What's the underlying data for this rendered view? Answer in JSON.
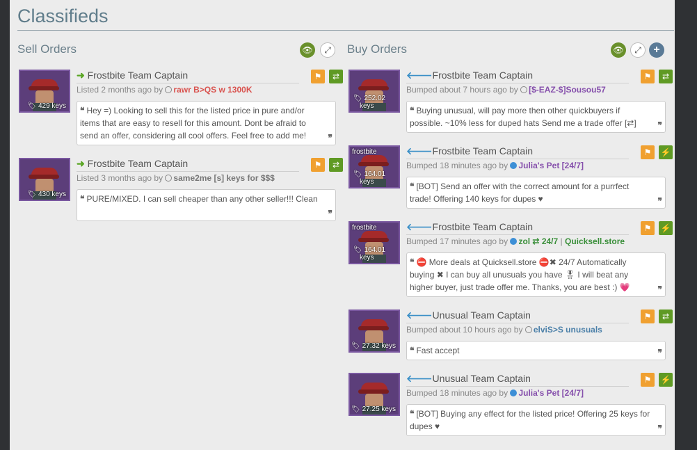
{
  "page_title": "Classifieds",
  "sell": {
    "title": "Sell Orders",
    "items": [
      {
        "name": "Frostbite Team Captain",
        "price": "429 keys",
        "meta_prefix": "Listed 2 months ago by",
        "user": "rawr B>QS w 1300K",
        "comment": "Hey =) Looking to sell this for the listed price in pure and/or items that are easy to resell for this amount. Dont be afraid to send an offer, considering all cool offers. Feel free to add me!"
      },
      {
        "name": "Frostbite Team Captain",
        "price": "430 keys",
        "meta_prefix": "Listed 3 months ago by",
        "user": "same2me [s] keys for $$$",
        "comment": "PURE/MIXED. I can sell cheaper than any other seller!!! Clean"
      }
    ]
  },
  "buy": {
    "title": "Buy Orders",
    "items": [
      {
        "name": "Frostbite Team Captain",
        "price_value": "252.02",
        "price_unit": "keys",
        "meta_prefix": "Bumped about 7 hours ago by",
        "user": "[$-EAZ-$]Sousou57",
        "comment": "Buying unusual, will pay more then other quickbuyers if possible. ~10% less for duped hats Send me a trade offer [⇄]"
      },
      {
        "name": "Frostbite Team Captain",
        "effect_label": "frostbite",
        "price_value": "164.01",
        "price_unit": "keys",
        "meta_prefix": "Bumped 18 minutes ago by",
        "user": "Julia's Pet [24/7]",
        "comment": "[BOT] Send an offer with the correct amount for a purrfect trade! Offering 140 keys for dupes ♥"
      },
      {
        "name": "Frostbite Team Captain",
        "effect_label": "frostbite",
        "price_value": "164.01",
        "price_unit": "keys",
        "meta_prefix": "Bumped 17 minutes ago by",
        "user": "zol ⇄ 24/7",
        "user_sep": "|",
        "user_extra": "Quicksell.store",
        "comment": "⛔ More deals at Quicksell.store ⛔✖ 24/7 Automatically buying ✖ I can buy all unusuals you have 🎖 I will beat any higher buyer, just trade offer me. Thanks, you are best :) 💗"
      },
      {
        "name": "Unusual Team Captain",
        "price": "27.32 keys",
        "meta_prefix": "Bumped about 10 hours ago by",
        "user": "elviS>S unusuals",
        "comment": "Fast accept"
      },
      {
        "name": "Unusual Team Captain",
        "price": "27.25 keys",
        "meta_prefix": "Bumped 18 minutes ago by",
        "user": "Julia's Pet [24/7]",
        "comment": "[BOT] Buying any effect for the listed price! Offering 25 keys for dupes ♥"
      }
    ]
  },
  "colors": {
    "accent_green": "#69902b",
    "flag_orange": "#f0a030",
    "title_blue": "#607d8b"
  }
}
